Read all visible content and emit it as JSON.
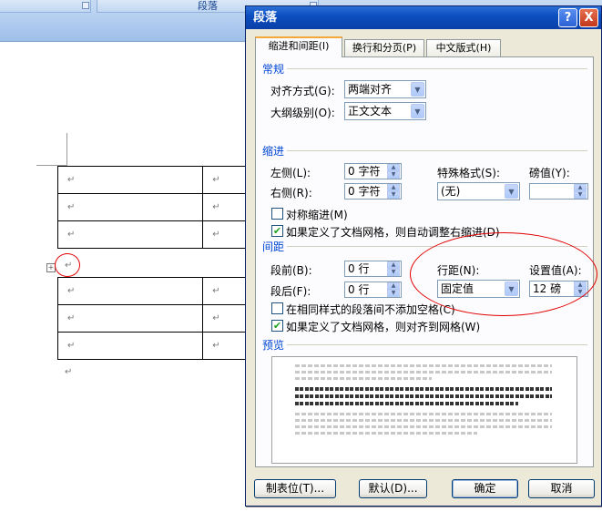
{
  "ribbon": {
    "group_label": "段落"
  },
  "document": {
    "para_mark": "↵"
  },
  "dialog": {
    "title": "段落",
    "help_icon_glyph": "?",
    "close_icon_glyph": "X",
    "tabs": [
      {
        "label": "缩进和间距(I)",
        "active": true
      },
      {
        "label": "换行和分页(P)",
        "active": false
      },
      {
        "label": "中文版式(H)",
        "active": false
      }
    ],
    "general": {
      "heading": "常规",
      "alignment_label": "对齐方式(G):",
      "alignment_value": "两端对齐",
      "outline_label": "大纲级别(O):",
      "outline_value": "正文文本"
    },
    "indent": {
      "heading": "缩进",
      "left_label": "左侧(L):",
      "left_value": "0 字符",
      "right_label": "右侧(R):",
      "right_value": "0 字符",
      "special_label": "特殊格式(S):",
      "special_value": "(无)",
      "by_label": "磅值(Y):",
      "by_value": "",
      "mirror_label": "对称缩进(M)",
      "mirror_checked": false,
      "auto_adjust_label": "如果定义了文档网格，则自动调整右缩进(D)",
      "auto_adjust_checked": true
    },
    "spacing": {
      "heading": "间距",
      "before_label": "段前(B):",
      "before_value": "0 行",
      "after_label": "段后(F):",
      "after_value": "0 行",
      "line_spacing_label": "行距(N):",
      "line_spacing_value": "固定值",
      "at_label": "设置值(A):",
      "at_value": "12 磅",
      "no_space_label": "在相同样式的段落间不添加空格(C)",
      "no_space_checked": false,
      "snap_grid_label": "如果定义了文档网格，则对齐到网格(W)",
      "snap_grid_checked": true
    },
    "preview": {
      "heading": "预览"
    },
    "buttons": {
      "tabs_label": "制表位(T)...",
      "default_label": "默认(D)...",
      "ok_label": "确定",
      "cancel_label": "取消"
    }
  },
  "colors": {
    "title_bar": "#0c4fc0",
    "section_heading": "#0046d5",
    "annotation": "#e00000"
  }
}
